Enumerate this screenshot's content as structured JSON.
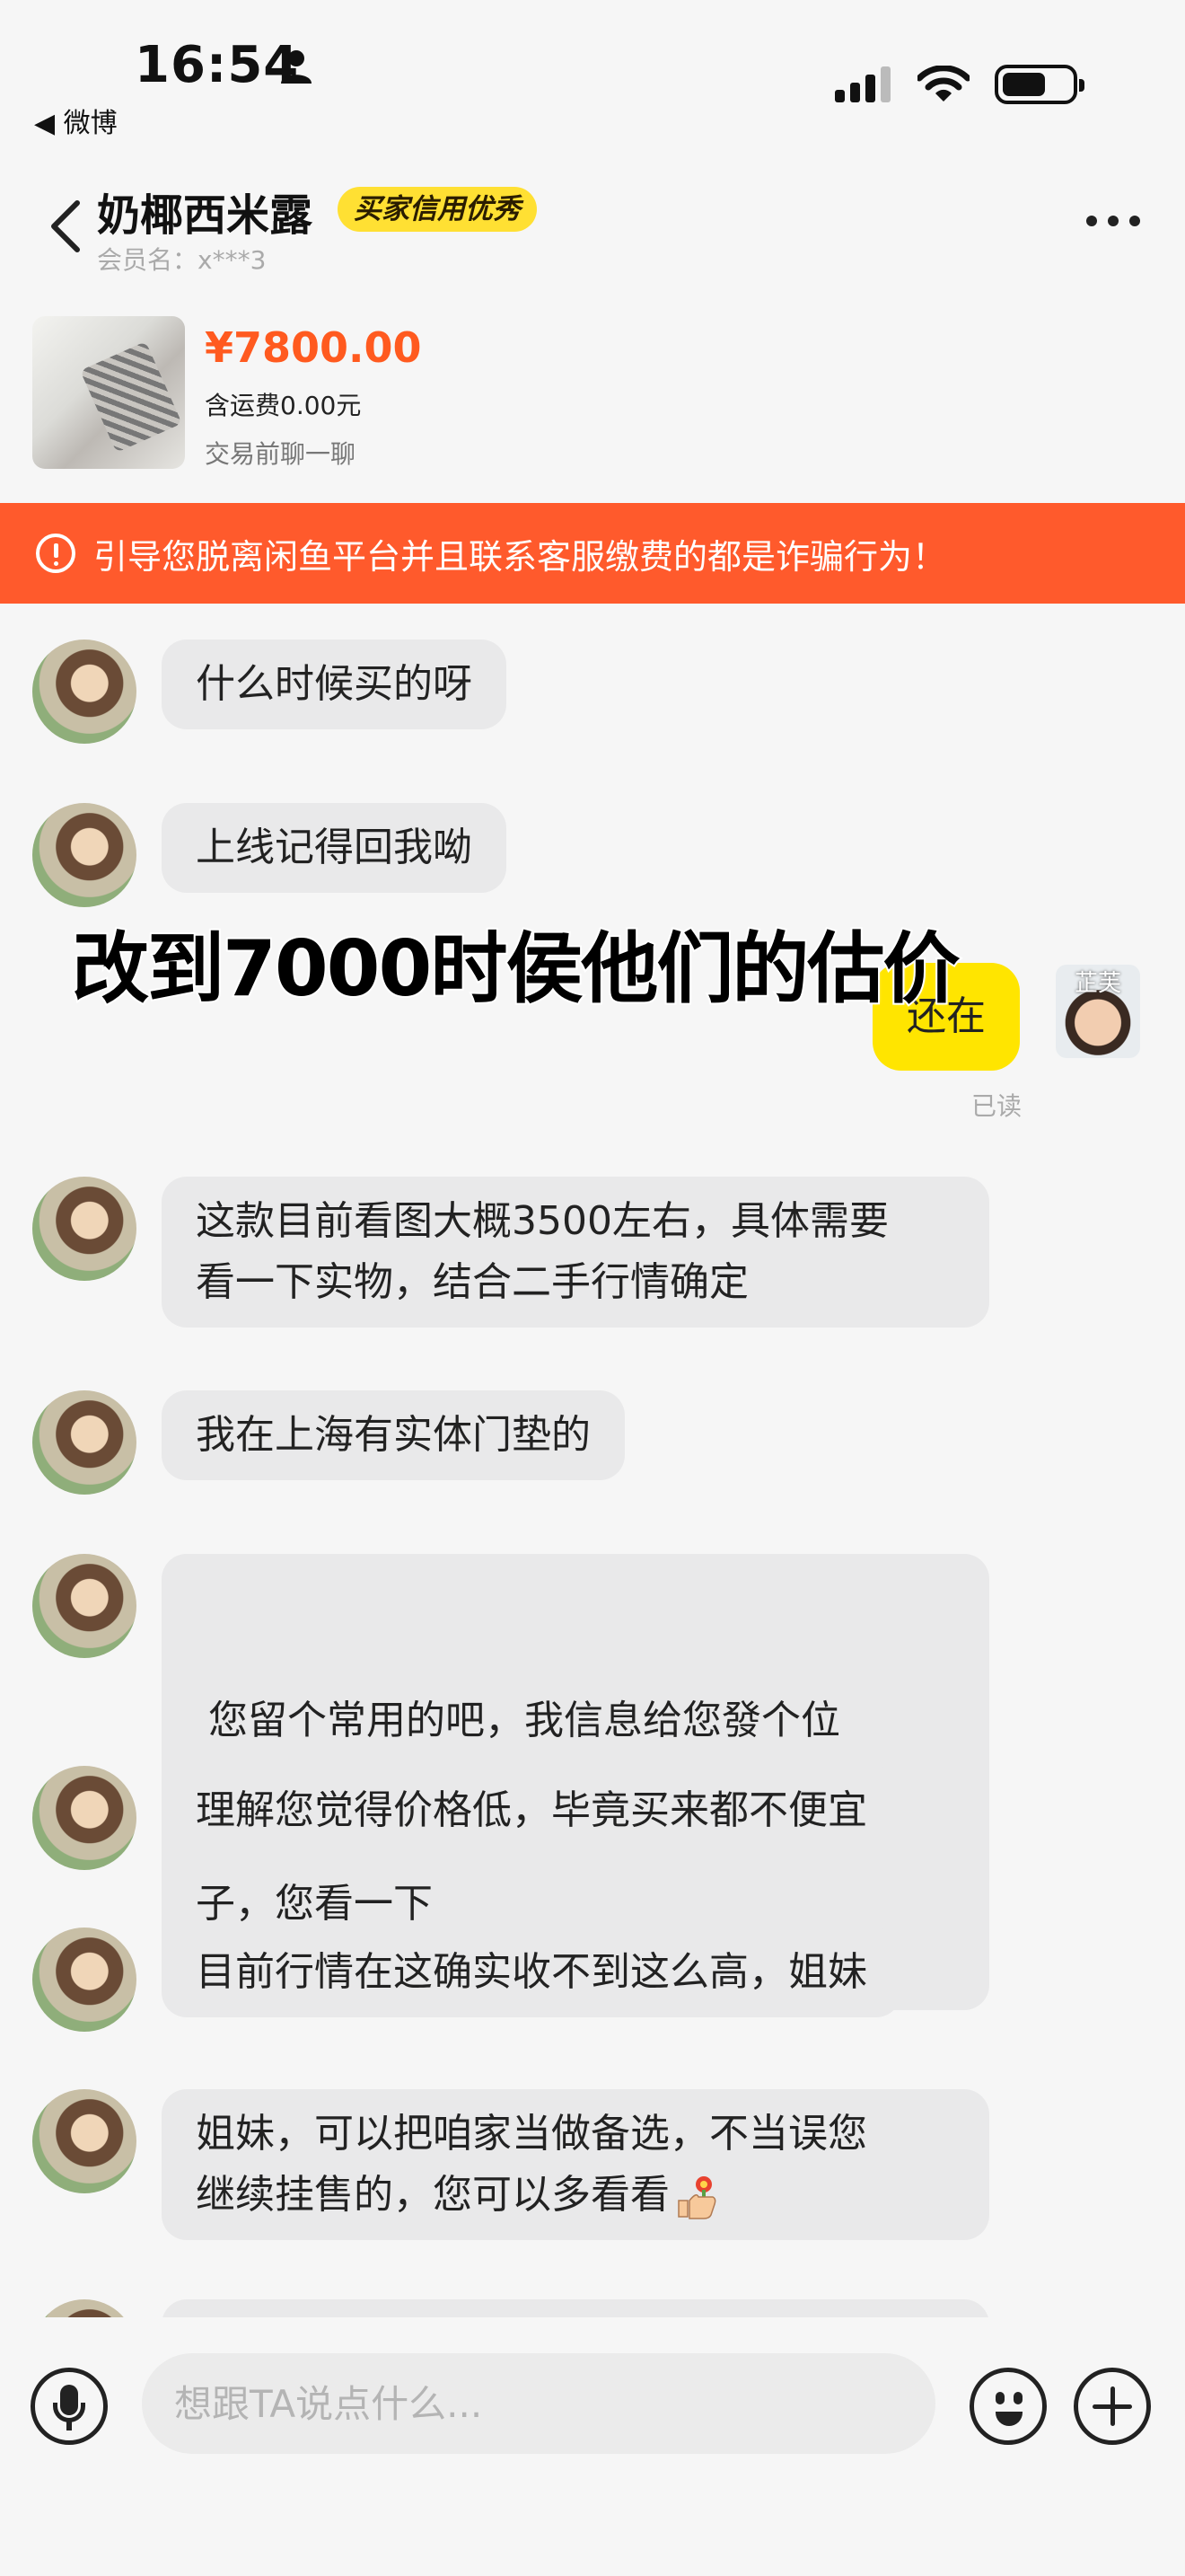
{
  "status_bar": {
    "time": "16:54",
    "back_app": "◀ 微博"
  },
  "header": {
    "title": "奶椰西米露",
    "credit_badge": "买家信用优秀",
    "member_name": "会员名：x***3"
  },
  "product": {
    "price": "¥7800.00",
    "shipping": "含运费0.00元",
    "chat_hint": "交易前聊一聊"
  },
  "warning": {
    "text": "引导您脱离闲鱼平台并且联系客服缴费的都是诈骗行为！"
  },
  "overlay_caption": "改到7000时侯他们的估价",
  "messages": {
    "m1": "什么时候买的呀",
    "m2": "上线记得回我呦",
    "m3": "还在",
    "m3_status": "已读",
    "m4_l1": "这款目前看图大概3500左右，具体需要",
    "m4_l2": "看一下实物，结合二手行情确定",
    "m5": "我在上海有实体门垫的",
    "m6_l1": " 您留个常用的吧，我信息给您發个位",
    "m6_l2": "子，您看一下",
    "m7": "理解您觉得价格低，毕竟买来都不便宜",
    "m8": "目前行情在这确实收不到这么高，姐妹",
    "m9_l1": "姐妹，可以把咱家当做备选，不当误您",
    "m9_l2": "继续挂售的，您可以多看看"
  },
  "my_avatar_label": "芷芙",
  "input": {
    "placeholder": "想跟TA说点什么..."
  },
  "colors": {
    "accent_orange": "#ff5a2c",
    "bubble_yellow": "#ffe500",
    "badge_yellow": "#ffe033",
    "price_orange": "#ff5a1f"
  },
  "icons": [
    "person-icon",
    "signal-icon",
    "wifi-icon",
    "battery-icon",
    "back-chevron-icon",
    "more-icon",
    "warning-icon",
    "mic-icon",
    "emoji-icon",
    "plus-icon",
    "thumbs-up-flower-icon"
  ]
}
